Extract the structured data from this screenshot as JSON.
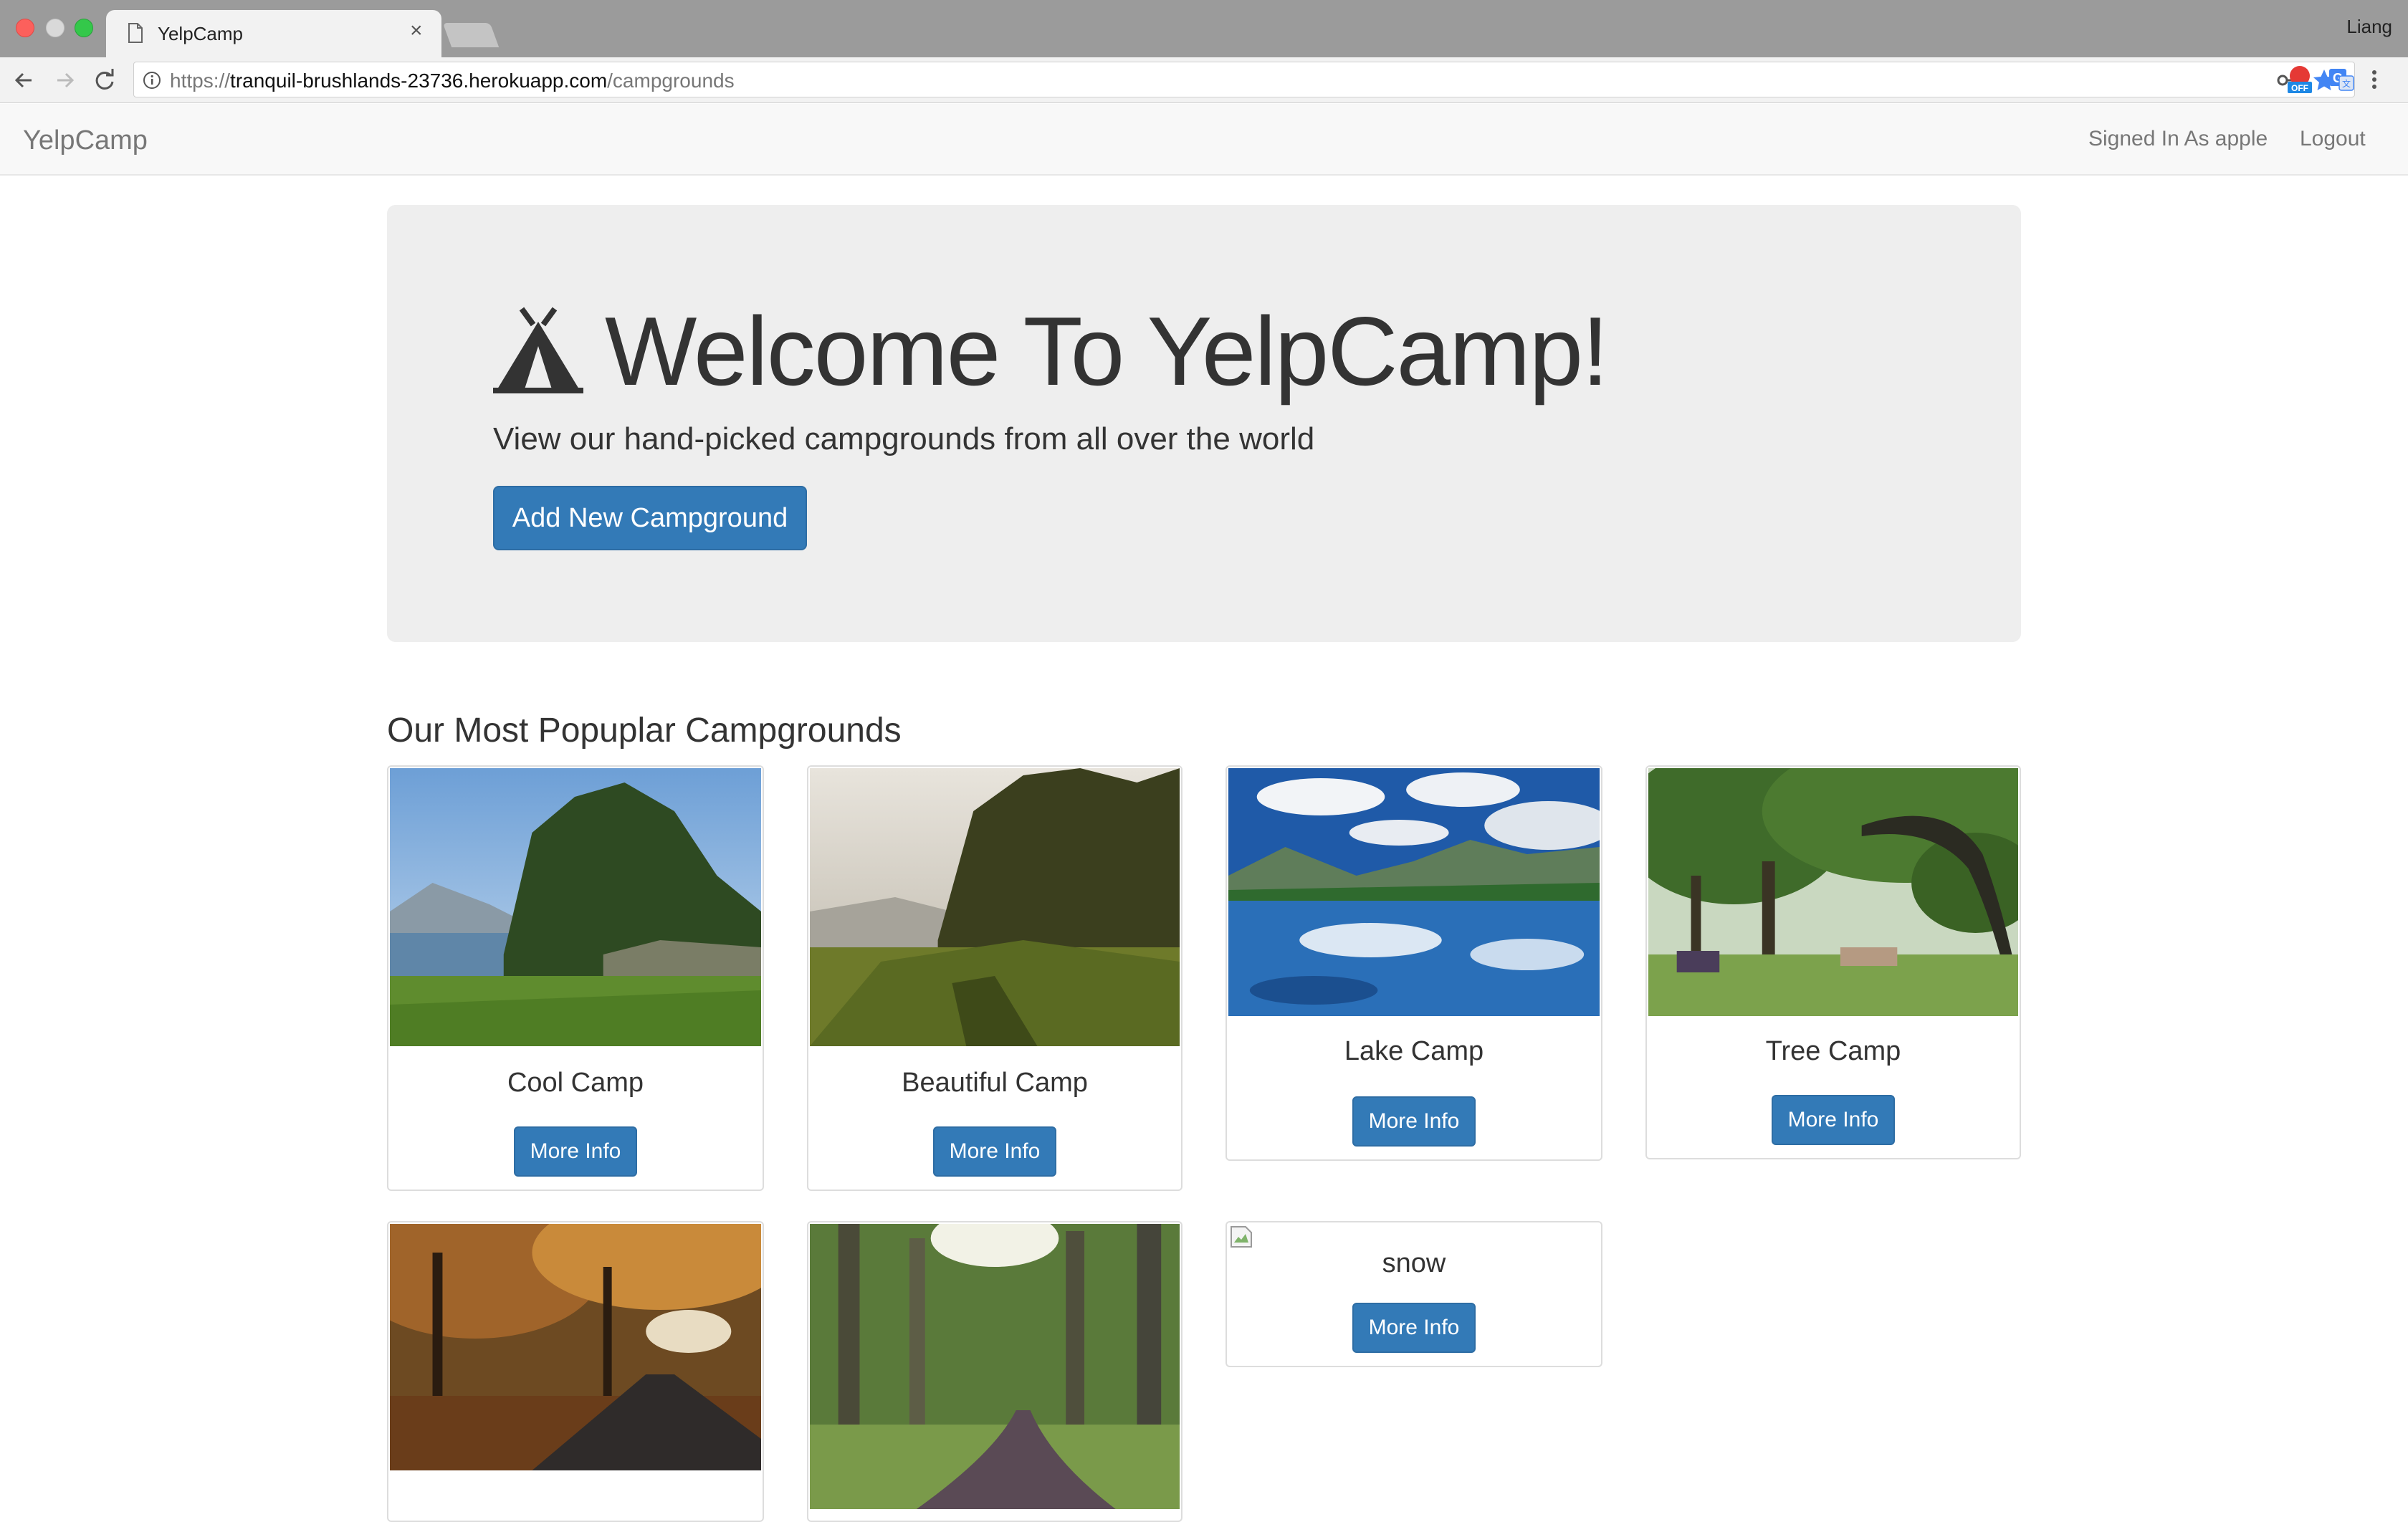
{
  "browser": {
    "tab_title": "YelpCamp",
    "profile_name": "Liang",
    "url_scheme": "https://",
    "url_host": "tranquil-brushlands-23736.herokuapp.com",
    "url_path": "/campgrounds",
    "extensions": [
      "adblock-off-icon",
      "translate-icon"
    ]
  },
  "navbar": {
    "brand": "YelpCamp",
    "signed_in": "Signed In As apple",
    "logout": "Logout"
  },
  "jumbotron": {
    "title": "Welcome To YelpCamp!",
    "subtitle": "View our hand-picked campgrounds from all over the world",
    "add_button": "Add New Campground"
  },
  "section": {
    "title": "Our Most Popuplar Campgrounds"
  },
  "campgrounds": [
    {
      "name": "Cool Camp",
      "button": "More Info",
      "image": "coast-forest-photo"
    },
    {
      "name": "Beautiful Camp",
      "button": "More Info",
      "image": "meadow-forest-photo"
    },
    {
      "name": "Lake Camp",
      "button": "More Info",
      "image": "mountain-lake-photo"
    },
    {
      "name": "Tree Camp",
      "button": "More Info",
      "image": "oak-trees-photo"
    },
    {
      "name": "",
      "button": "",
      "image": "autumn-road-photo"
    },
    {
      "name": "",
      "button": "",
      "image": "forest-path-photo"
    },
    {
      "name": "snow",
      "button": "More Info",
      "image": "broken-image"
    }
  ],
  "colors": {
    "primary": "#337ab7",
    "jumbotron_bg": "#eeeeee",
    "navbar_bg": "#f8f8f8"
  }
}
